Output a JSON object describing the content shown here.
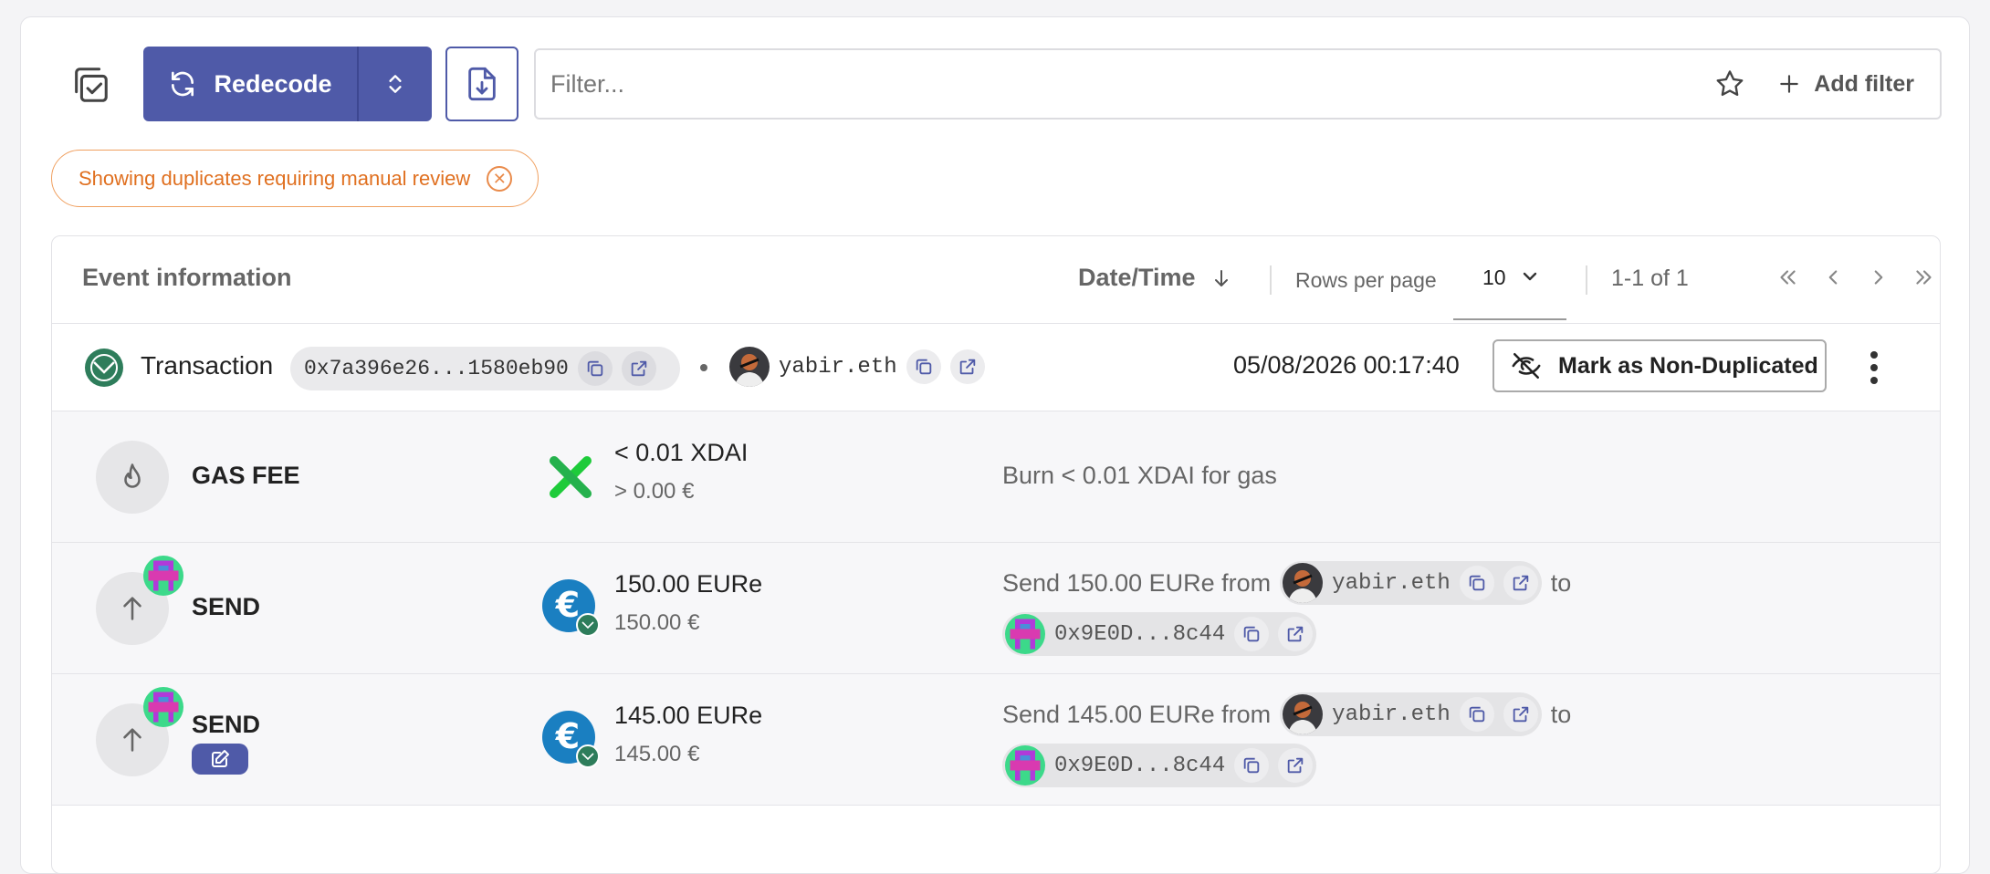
{
  "toolbar": {
    "redecode_label": "Redecode",
    "filter_placeholder": "Filter...",
    "add_filter_label": "Add filter"
  },
  "notice_chip": {
    "label": "Showing duplicates requiring manual review"
  },
  "table": {
    "header_title": "Event information",
    "sort_label": "Date/Time",
    "rows_per_page_label": "Rows per page",
    "rows_per_page_value": "10",
    "page_info": "1-1 of 1"
  },
  "transaction": {
    "label": "Transaction",
    "hash": "0x7a396e26...1580eb90",
    "address": "yabir.eth",
    "datetime": "05/08/2026 00:17:40",
    "mark_button": "Mark as Non-Duplicated"
  },
  "events": [
    {
      "type": "GAS FEE",
      "amount": "< 0.01 XDAI",
      "fiat": "> 0.00 €",
      "description": "Burn < 0.01 XDAI for gas"
    },
    {
      "type": "SEND",
      "amount": "150.00 EURe",
      "fiat": "150.00 €",
      "desc_prefix": "Send 150.00 EURe from",
      "from": "yabir.eth",
      "to_word": "to",
      "to": "0x9E0D...8c44"
    },
    {
      "type": "SEND",
      "amount": "145.00 EURe",
      "fiat": "145.00 €",
      "desc_prefix": "Send 145.00 EURe from",
      "from": "yabir.eth",
      "to_word": "to",
      "to": "0x9E0D...8c44"
    }
  ],
  "colors": {
    "primary": "#4f5aa8",
    "warning": "#e07020",
    "gnosis_green": "#2e7d5b",
    "eure_blue": "#1a7fc1"
  }
}
